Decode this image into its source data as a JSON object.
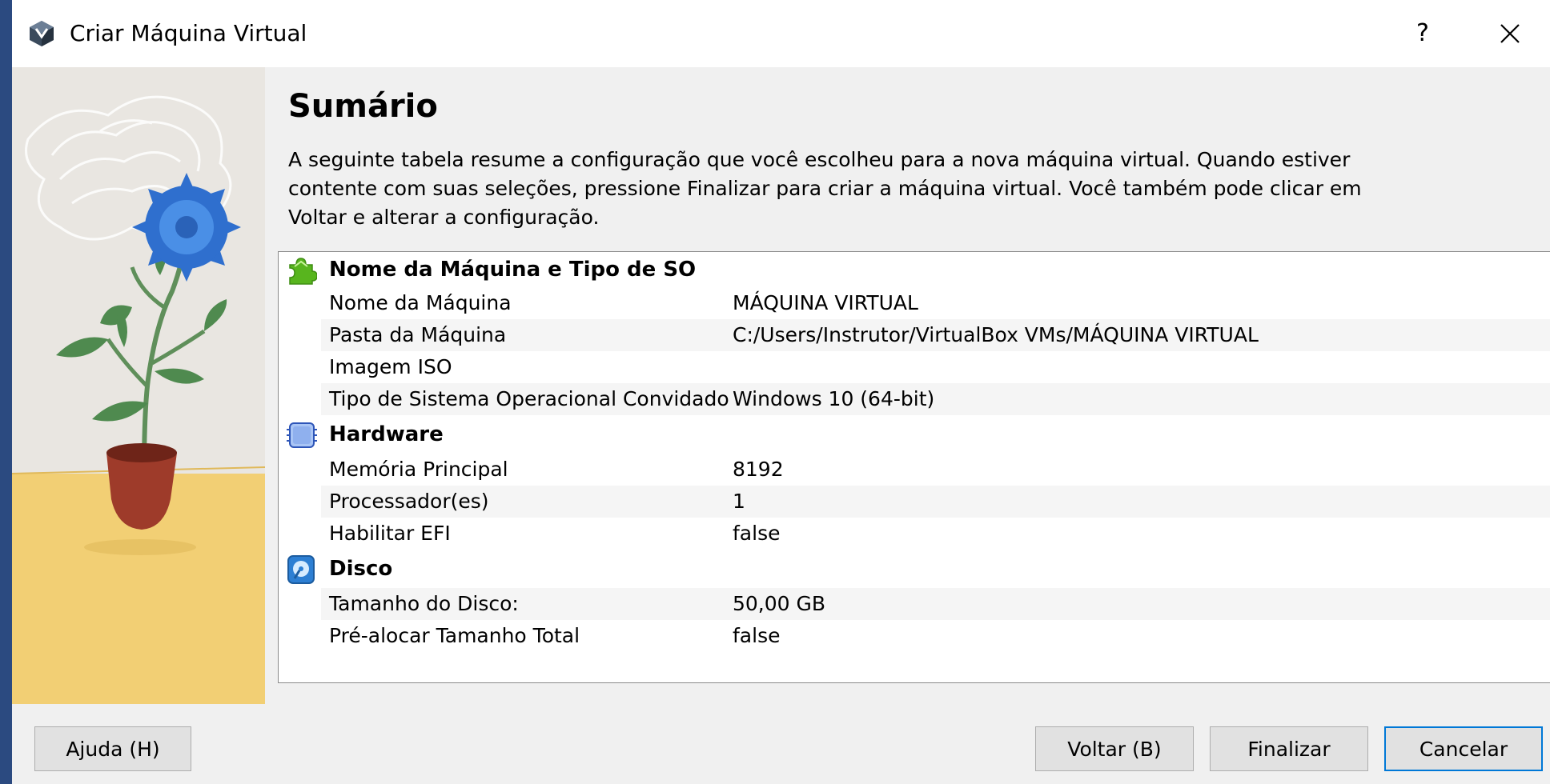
{
  "window": {
    "title": "Criar Máquina Virtual"
  },
  "titlebar": {
    "help_label": "?",
    "icons": [
      "virtualbox-icon",
      "close-icon"
    ]
  },
  "page": {
    "heading": "Sumário",
    "description": "A seguinte tabela resume a configuração que você escolheu para a nova máquina virtual. Quando estiver contente com suas seleções, pressione Finalizar para criar a máquina virtual. Você também pode clicar em Voltar e alterar a configuração."
  },
  "summary": {
    "sections": [
      {
        "title": "Nome da Máquina e Tipo de SO",
        "icon": "os-puzzle-icon",
        "rows": [
          {
            "label": "Nome da Máquina",
            "value": "MÁQUINA VIRTUAL"
          },
          {
            "label": "Pasta da Máquina",
            "value": "C:/Users/Instrutor/VirtualBox VMs/MÁQUINA VIRTUAL"
          },
          {
            "label": "Imagem ISO",
            "value": ""
          },
          {
            "label": "Tipo de Sistema Operacional Convidado",
            "value": "Windows 10 (64-bit)"
          }
        ]
      },
      {
        "title": "Hardware",
        "icon": "chip-icon",
        "rows": [
          {
            "label": "Memória Principal",
            "value": "8192"
          },
          {
            "label": "Processador(es)",
            "value": "1"
          },
          {
            "label": "Habilitar EFI",
            "value": "false"
          }
        ]
      },
      {
        "title": "Disco",
        "icon": "disk-icon",
        "rows": [
          {
            "label": "Tamanho do Disco:",
            "value": "50,00 GB"
          },
          {
            "label": "Pré-alocar Tamanho Total",
            "value": "false"
          }
        ]
      }
    ]
  },
  "buttons": {
    "help": "Ajuda (H)",
    "back": "Voltar (B)",
    "finish": "Finalizar",
    "cancel": "Cancelar"
  },
  "colors": {
    "desktop": "#2b4a80",
    "dialog": "#f0f0f0",
    "table_band": "#f5f5f5",
    "default_button_border": "#0078d7"
  }
}
